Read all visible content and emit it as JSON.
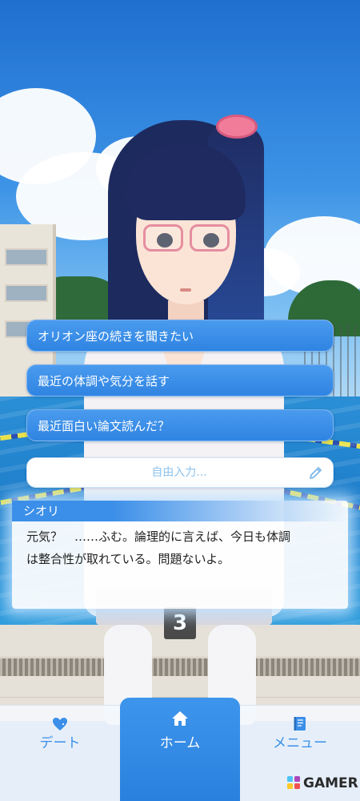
{
  "choices": [
    {
      "label": "オリオン座の続きを聞きたい"
    },
    {
      "label": "最近の体調や気分を話す"
    },
    {
      "label": "最近面白い論文読んだ？"
    }
  ],
  "free_input": {
    "placeholder": "自由入力..."
  },
  "dialogue": {
    "speaker": "シオリ",
    "lines": [
      "元気？　……ふむ。論理的に言えば、今日も体調",
      "は整合性が取れている。問題ないよ。"
    ]
  },
  "scene": {
    "lane_number": "3"
  },
  "nav": {
    "items": [
      {
        "label": "デート",
        "icon": "heart-icon"
      },
      {
        "label": "ホーム",
        "icon": "home-icon"
      },
      {
        "label": "メニュー",
        "icon": "menu-book-icon"
      }
    ],
    "active": "ホーム"
  },
  "watermark": {
    "text": "GAMER"
  },
  "colors": {
    "accent": "#3b8fe8",
    "nav_active": "#2f86e4",
    "nav_inactive_text": "#3b8fe8"
  }
}
